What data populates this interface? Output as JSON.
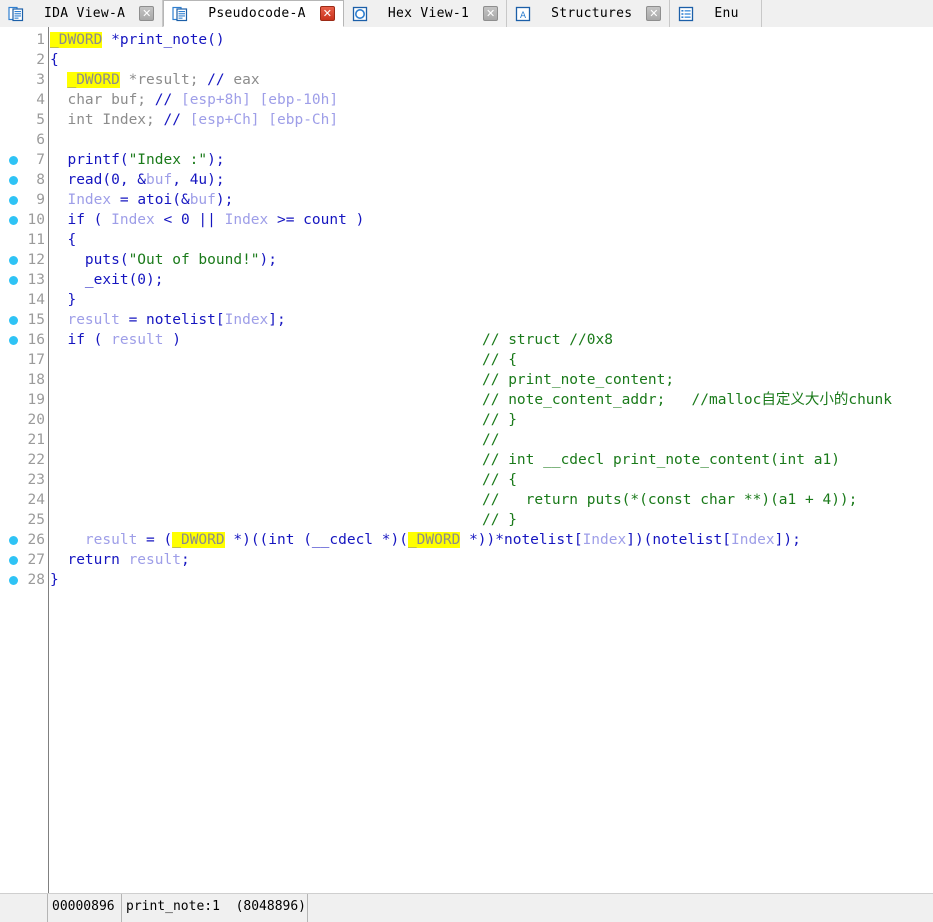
{
  "window": {
    "title": "Pseudocode-A",
    "colors": {
      "keyword_highlight": "#ffff00",
      "comment": "#1a7a1a",
      "string": "#1a7a1a",
      "variable": "#9e9ee8",
      "code": "#1515c0",
      "dim": "#8c8c8c",
      "line_number": "#9b9b9b",
      "breakpoint": "#2fc3f5",
      "tab_active_bg": "#ffffff",
      "tab_bg": "#f0f0f0",
      "close_red": "#c9321c"
    }
  },
  "tabs": [
    {
      "label": "IDA View-A",
      "icon": "ida-view-icon",
      "active": false,
      "close_label": "✕",
      "close_style": "grey"
    },
    {
      "label": "Pseudocode-A",
      "icon": "pseudocode-icon",
      "active": true,
      "close_label": "✕",
      "close_style": "red"
    },
    {
      "label": "Hex View-1",
      "icon": "hex-view-icon",
      "active": false,
      "close_label": "✕",
      "close_style": "grey"
    },
    {
      "label": "Structures",
      "icon": "structures-icon",
      "active": false,
      "close_label": "✕",
      "close_style": "grey"
    },
    {
      "label": "Enu",
      "icon": "enums-icon",
      "active": false,
      "close_label": "",
      "close_style": "none"
    }
  ],
  "code": {
    "function_name": "print_note",
    "lines": [
      {
        "n": 1,
        "bp": false,
        "tokens": [
          {
            "t": "_DWORD",
            "c": "kw"
          },
          {
            "t": " *print_note()",
            "c": "blue"
          }
        ]
      },
      {
        "n": 2,
        "bp": false,
        "tokens": [
          {
            "t": "{",
            "c": "blue"
          }
        ]
      },
      {
        "n": 3,
        "bp": false,
        "tokens": [
          {
            "t": "  ",
            "c": "plain"
          },
          {
            "t": "_DWORD",
            "c": "kw"
          },
          {
            "t": " *result; ",
            "c": "dim"
          },
          {
            "t": "// ",
            "c": "blue"
          },
          {
            "t": "eax",
            "c": "dim"
          }
        ]
      },
      {
        "n": 4,
        "bp": false,
        "tokens": [
          {
            "t": "  char buf; ",
            "c": "dim"
          },
          {
            "t": "// ",
            "c": "blue"
          },
          {
            "t": "[esp+8h] [ebp-10h]",
            "c": "var"
          }
        ]
      },
      {
        "n": 5,
        "bp": false,
        "tokens": [
          {
            "t": "  int Index; ",
            "c": "dim"
          },
          {
            "t": "// ",
            "c": "blue"
          },
          {
            "t": "[esp+Ch] [ebp-Ch]",
            "c": "var"
          }
        ]
      },
      {
        "n": 6,
        "bp": false,
        "tokens": []
      },
      {
        "n": 7,
        "bp": true,
        "tokens": [
          {
            "t": "  printf(",
            "c": "blue"
          },
          {
            "t": "\"Index :\"",
            "c": "str"
          },
          {
            "t": ");",
            "c": "blue"
          }
        ]
      },
      {
        "n": 8,
        "bp": true,
        "tokens": [
          {
            "t": "  read(0, &",
            "c": "blue"
          },
          {
            "t": "buf",
            "c": "var"
          },
          {
            "t": ", 4u);",
            "c": "blue"
          }
        ]
      },
      {
        "n": 9,
        "bp": true,
        "tokens": [
          {
            "t": "  ",
            "c": "blue"
          },
          {
            "t": "Index",
            "c": "var"
          },
          {
            "t": " = atoi(&",
            "c": "blue"
          },
          {
            "t": "buf",
            "c": "var"
          },
          {
            "t": ");",
            "c": "blue"
          }
        ]
      },
      {
        "n": 10,
        "bp": true,
        "tokens": [
          {
            "t": "  if ( ",
            "c": "blue"
          },
          {
            "t": "Index",
            "c": "var"
          },
          {
            "t": " < 0 || ",
            "c": "blue"
          },
          {
            "t": "Index",
            "c": "var"
          },
          {
            "t": " >= count )",
            "c": "blue"
          }
        ]
      },
      {
        "n": 11,
        "bp": false,
        "tokens": [
          {
            "t": "  {",
            "c": "blue"
          }
        ]
      },
      {
        "n": 12,
        "bp": true,
        "tokens": [
          {
            "t": "    puts(",
            "c": "blue"
          },
          {
            "t": "\"Out of bound!\"",
            "c": "str"
          },
          {
            "t": ");",
            "c": "blue"
          }
        ]
      },
      {
        "n": 13,
        "bp": true,
        "tokens": [
          {
            "t": "    _exit(0);",
            "c": "blue"
          }
        ]
      },
      {
        "n": 14,
        "bp": false,
        "tokens": [
          {
            "t": "  }",
            "c": "blue"
          }
        ]
      },
      {
        "n": 15,
        "bp": true,
        "tokens": [
          {
            "t": "  ",
            "c": "blue"
          },
          {
            "t": "result",
            "c": "var"
          },
          {
            "t": " = notelist[",
            "c": "blue"
          },
          {
            "t": "Index",
            "c": "var"
          },
          {
            "t": "];",
            "c": "blue"
          }
        ]
      },
      {
        "n": 16,
        "bp": true,
        "tokens": [
          {
            "t": "  if ( ",
            "c": "blue"
          },
          {
            "t": "result",
            "c": "var"
          },
          {
            "t": " )",
            "c": "blue"
          }
        ],
        "comment": "// struct //0x8"
      },
      {
        "n": 17,
        "bp": false,
        "tokens": [],
        "comment": "// {"
      },
      {
        "n": 18,
        "bp": false,
        "tokens": [],
        "comment": "// print_note_content;"
      },
      {
        "n": 19,
        "bp": false,
        "tokens": [],
        "comment": "// note_content_addr;   //malloc自定义大小的chunk"
      },
      {
        "n": 20,
        "bp": false,
        "tokens": [],
        "comment": "// }"
      },
      {
        "n": 21,
        "bp": false,
        "tokens": [],
        "comment": "//"
      },
      {
        "n": 22,
        "bp": false,
        "tokens": [],
        "comment": "// int __cdecl print_note_content(int a1)"
      },
      {
        "n": 23,
        "bp": false,
        "tokens": [],
        "comment": "// {"
      },
      {
        "n": 24,
        "bp": false,
        "tokens": [],
        "comment": "//   return puts(*(const char **)(a1 + 4));"
      },
      {
        "n": 25,
        "bp": false,
        "tokens": [],
        "comment": "// }"
      },
      {
        "n": 26,
        "bp": true,
        "tokens": [
          {
            "t": "    ",
            "c": "blue"
          },
          {
            "t": "result",
            "c": "var"
          },
          {
            "t": " = (",
            "c": "blue"
          },
          {
            "t": "_DWORD",
            "c": "kw"
          },
          {
            "t": " *)((int (__cdecl *)(",
            "c": "blue"
          },
          {
            "t": "_DWORD",
            "c": "kw"
          },
          {
            "t": " *))*notelist[",
            "c": "blue"
          },
          {
            "t": "Index",
            "c": "var"
          },
          {
            "t": "])(notelist[",
            "c": "blue"
          },
          {
            "t": "Index",
            "c": "var"
          },
          {
            "t": "]);",
            "c": "blue"
          }
        ]
      },
      {
        "n": 27,
        "bp": true,
        "tokens": [
          {
            "t": "  return ",
            "c": "blue"
          },
          {
            "t": "result",
            "c": "var"
          },
          {
            "t": ";",
            "c": "blue"
          }
        ]
      },
      {
        "n": 28,
        "bp": true,
        "tokens": [
          {
            "t": "}",
            "c": "blue"
          }
        ]
      }
    ]
  },
  "status_bar": {
    "address": "00000896",
    "location": "print_note:1  (8048896)"
  }
}
